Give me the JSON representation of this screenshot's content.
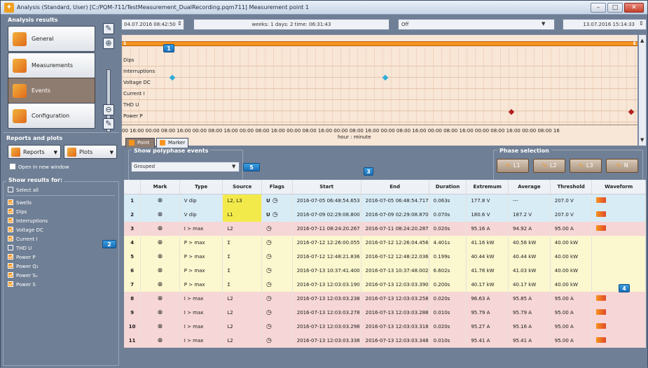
{
  "window": {
    "title": "Analysis (Standard, User) [C:/PQM-711/TestMeasurement_DualRecording.pqm711] Measurement point 1"
  },
  "left_panel": {
    "analysis_title": "Analysis results",
    "nav": [
      {
        "label": "General"
      },
      {
        "label": "Measurements"
      },
      {
        "label": "Events"
      },
      {
        "label": "Configuration"
      }
    ],
    "reports_title": "Reports and plots",
    "reports_label": "Reports",
    "plots_label": "Plots",
    "open_new_window": "Open in new window",
    "show_results_title": "Show results for:",
    "select_all": "Select all",
    "results_items": [
      {
        "label": "Swells",
        "checked": true
      },
      {
        "label": "Dips",
        "checked": true
      },
      {
        "label": "Interruptions",
        "checked": true
      },
      {
        "label": "Voltage DC",
        "checked": true
      },
      {
        "label": "Current I",
        "checked": true
      },
      {
        "label": "THD U",
        "checked": false
      },
      {
        "label": "Power P",
        "checked": true
      },
      {
        "label": "Power Q₁",
        "checked": true
      },
      {
        "label": "Power Sₙ",
        "checked": true
      },
      {
        "label": "Power S",
        "checked": true
      }
    ]
  },
  "timeline": {
    "date_from": "04.07.2016 08:42:50",
    "period": "weeks: 1 days: 2 time: 06:31:43",
    "mode": "Off",
    "date_to": "13.07.2016 15:14:33",
    "rows": [
      "Dips",
      "Interruptions",
      "Voltage DC",
      "Current I",
      "THD U",
      "Power P"
    ],
    "ticks": "00  16:00  00:00  08:00  16:00  00:00  08:00  16:00  00:00  08:00  16:00  00:00  08:00  16:00  00:00  08:00  16:00  00:00  08:00  16:00  00:00  08:00  16:00  00:00  08:00  16:00  00:00  08:00  16",
    "axis_label": "hour : minute",
    "bar_start": "S",
    "bar_end": "E"
  },
  "tabs": {
    "point": "Point",
    "marker": "Marker"
  },
  "filters": {
    "polyphase_title": "Show polyphase events",
    "polyphase_value": "Grouped",
    "phase_title": "Phase selection",
    "phases": [
      "L1",
      "L2",
      "L3",
      "N"
    ]
  },
  "callouts": {
    "c1": "1",
    "c2": "2",
    "c3": "3",
    "c4": "4",
    "c5": "5"
  },
  "table": {
    "headers": [
      "",
      "Mark",
      "Type",
      "Source",
      "Flags",
      "Start",
      "End",
      "Duration",
      "Extremum",
      "Average",
      "Threshold",
      "Waveform"
    ],
    "rows": [
      {
        "n": "1",
        "type": "V dip",
        "source": "L2, L3",
        "flag_u": "U",
        "start": "2016-07-05 06:48:54.653",
        "end": "2016-07-05 06:48:54.717",
        "duration": "0.063s",
        "extremum": "177.8 V",
        "average": "---",
        "threshold": "207.0 V",
        "wave": true,
        "color": "blue",
        "hl": true
      },
      {
        "n": "2",
        "type": "V dip",
        "source": "L1",
        "flag_u": "U",
        "start": "2016-07-09 02:29:08.800",
        "end": "2016-07-09 02:29:08.870",
        "duration": "0.070s",
        "extremum": "180.6 V",
        "average": "187.2 V",
        "threshold": "207.0 V",
        "wave": true,
        "color": "blue",
        "hl": true
      },
      {
        "n": "3",
        "type": "I > max",
        "source": "L2",
        "flag_u": "",
        "start": "2016-07-11 08:24:20.267",
        "end": "2016-07-11 08:24:20.287",
        "duration": "0.020s",
        "extremum": "95.16 A",
        "average": "94.92 A",
        "threshold": "95.00 A",
        "wave": true,
        "color": "pink",
        "hl": false
      },
      {
        "n": "4",
        "type": "P > max",
        "source": "Σ",
        "flag_u": "",
        "start": "2016-07-12 12:26:00.055",
        "end": "2016-07-12 12:26:04.456",
        "duration": "4.401s",
        "extremum": "41.16 kW",
        "average": "40.58 kW",
        "threshold": "40.00 kW",
        "wave": false,
        "color": "yellow",
        "hl": false
      },
      {
        "n": "5",
        "type": "P > max",
        "source": "Σ",
        "flag_u": "",
        "start": "2016-07-12 12:48:21.836",
        "end": "2016-07-12 12:48:22.036",
        "duration": "0.199s",
        "extremum": "40.44 kW",
        "average": "40.44 kW",
        "threshold": "40.00 kW",
        "wave": false,
        "color": "yellow",
        "hl": false
      },
      {
        "n": "6",
        "type": "P > max",
        "source": "Σ",
        "flag_u": "",
        "start": "2016-07-13 10:37:41.400",
        "end": "2016-07-13 10:37:48.002",
        "duration": "6.602s",
        "extremum": "41.78 kW",
        "average": "41.03 kW",
        "threshold": "40.00 kW",
        "wave": false,
        "color": "yellow",
        "hl": false
      },
      {
        "n": "7",
        "type": "P > max",
        "source": "Σ",
        "flag_u": "",
        "start": "2016-07-13 12:03:03.190",
        "end": "2016-07-13 12:03:03.390",
        "duration": "0.200s",
        "extremum": "40.17 kW",
        "average": "40.17 kW",
        "threshold": "40.00 kW",
        "wave": false,
        "color": "yellow",
        "hl": false
      },
      {
        "n": "8",
        "type": "I > max",
        "source": "L2",
        "flag_u": "",
        "start": "2016-07-13 12:03:03.238",
        "end": "2016-07-13 12:03:03.258",
        "duration": "0.020s",
        "extremum": "96.63 A",
        "average": "95.85 A",
        "threshold": "95.00 A",
        "wave": true,
        "color": "pink",
        "hl": false
      },
      {
        "n": "9",
        "type": "I > max",
        "source": "L2",
        "flag_u": "",
        "start": "2016-07-13 12:03:03.278",
        "end": "2016-07-13 12:03:03.288",
        "duration": "0.010s",
        "extremum": "95.79 A",
        "average": "95.79 A",
        "threshold": "95.00 A",
        "wave": true,
        "color": "pink",
        "hl": false
      },
      {
        "n": "10",
        "type": "I > max",
        "source": "L2",
        "flag_u": "",
        "start": "2016-07-13 12:03:03.298",
        "end": "2016-07-13 12:03:03.318",
        "duration": "0.020s",
        "extremum": "95.27 A",
        "average": "95.16 A",
        "threshold": "95.00 A",
        "wave": true,
        "color": "pink",
        "hl": false
      },
      {
        "n": "11",
        "type": "I > max",
        "source": "L2",
        "flag_u": "",
        "start": "2016-07-13 12:03:03.338",
        "end": "2016-07-13 12:03:03.348",
        "duration": "0.010s",
        "extremum": "95.41 A",
        "average": "95.41 A",
        "threshold": "95.00 A",
        "wave": true,
        "color": "pink",
        "hl": false
      }
    ]
  }
}
